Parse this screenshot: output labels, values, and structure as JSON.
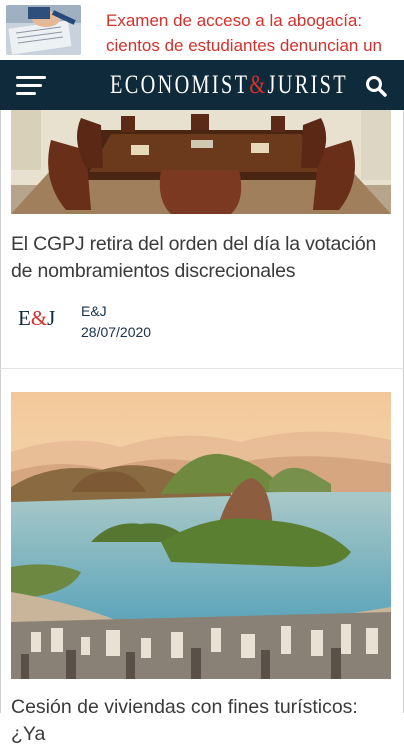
{
  "top_banner": {
    "title": "Examen de acceso a la abogacía: cientos de estudiantes denuncian un fallo"
  },
  "header": {
    "logo_left": "ECONOMIST",
    "logo_amp": "&",
    "logo_right": "JURIST"
  },
  "articles": [
    {
      "title": "El  CGPJ retira del orden del día la votación de nombramientos discrecionales",
      "avatar_left": "E",
      "avatar_amp": "&",
      "avatar_right": "J",
      "author": "E&J",
      "date": "28/07/2020"
    },
    {
      "title": "Cesión de viviendas con fines turísticos: ¿Ya"
    }
  ],
  "colors": {
    "header_bg": "#0f2a3b",
    "accent": "#d2322d"
  }
}
